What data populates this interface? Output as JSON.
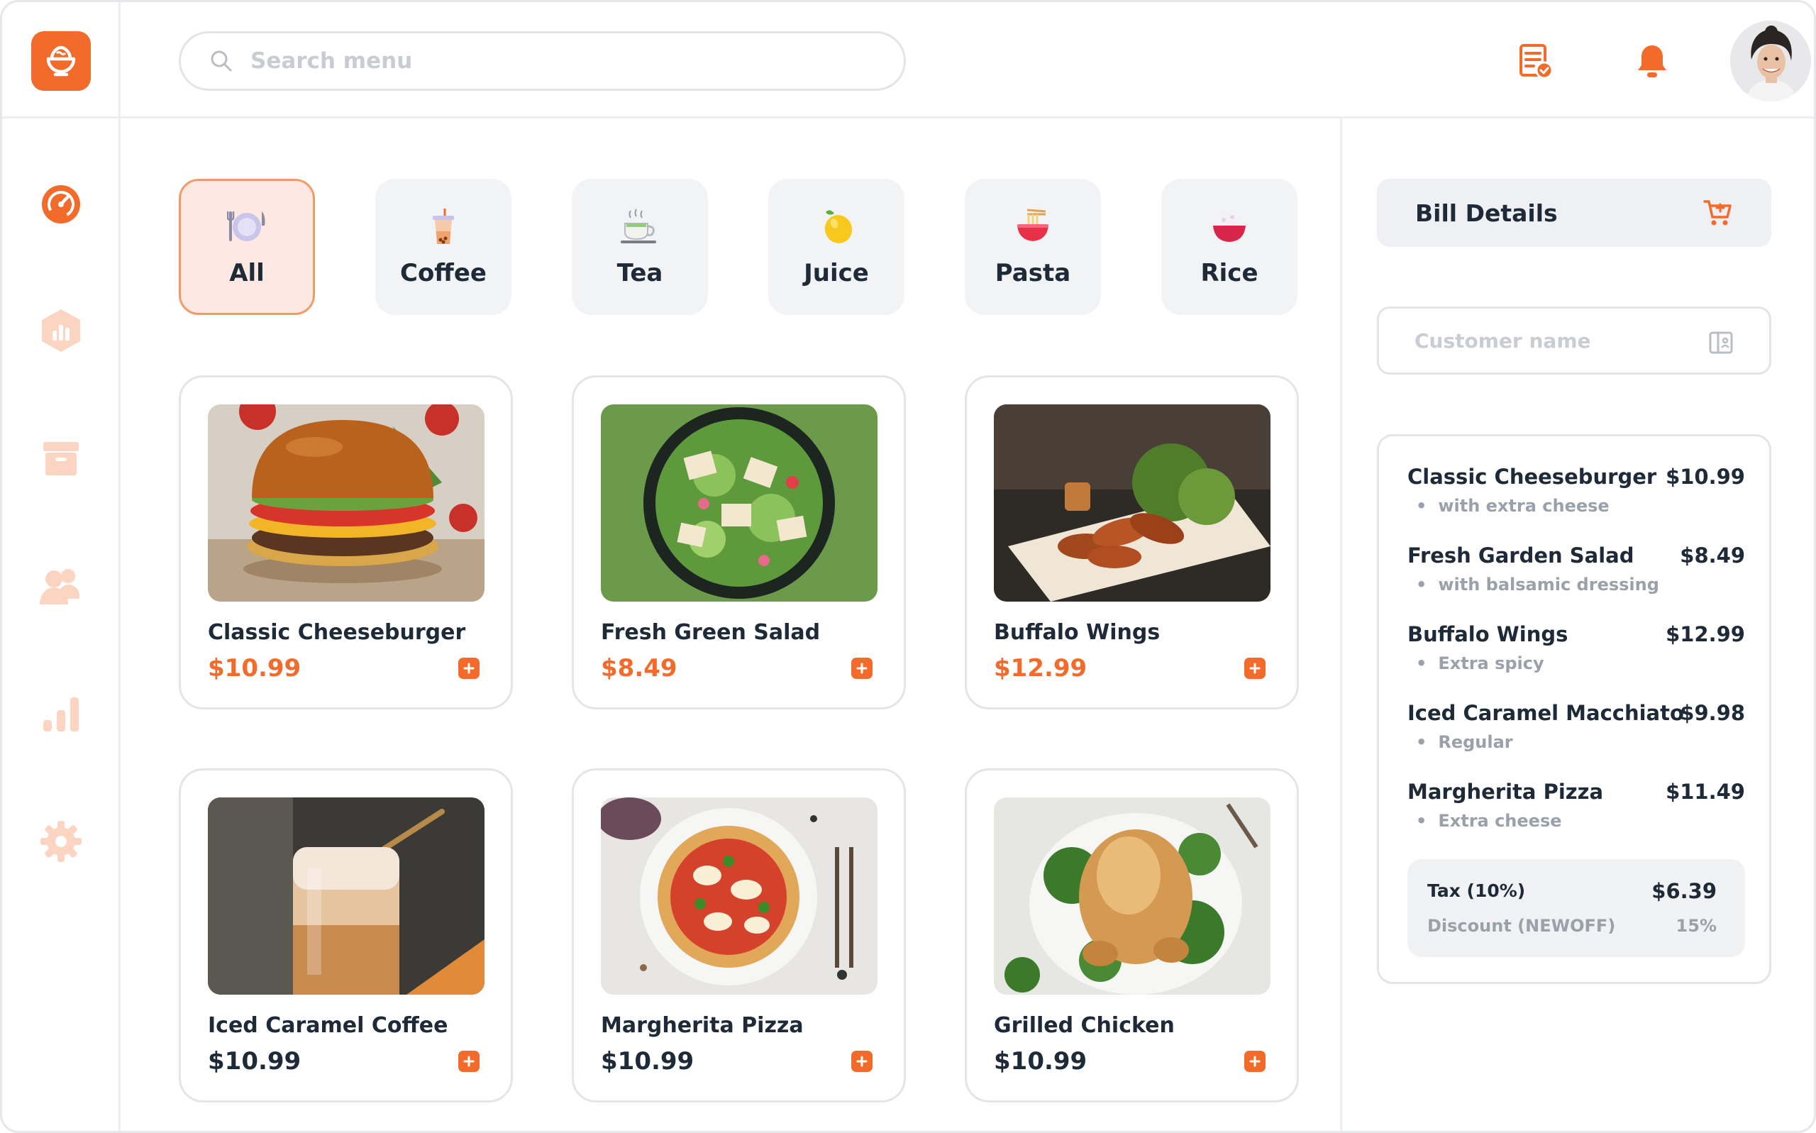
{
  "colors": {
    "accent": "#f26b2a",
    "accent_light": "#fde9e1",
    "text_dark": "#1e2a38",
    "muted": "#9aa1ab"
  },
  "header": {
    "search_placeholder": "Search menu",
    "icons": [
      "order-list-icon",
      "bell-icon"
    ],
    "avatar": "user-avatar"
  },
  "sidebar": {
    "items": [
      {
        "icon": "dashboard-icon",
        "active": true
      },
      {
        "icon": "analytics-hexagon-icon",
        "active": false
      },
      {
        "icon": "archive-box-icon",
        "active": false
      },
      {
        "icon": "users-icon",
        "active": false
      },
      {
        "icon": "bar-chart-icon",
        "active": false
      },
      {
        "icon": "settings-gear-icon",
        "active": false
      }
    ]
  },
  "categories": [
    {
      "label": "All",
      "icon": "plate-utensils-icon",
      "active": true
    },
    {
      "label": "Coffee",
      "icon": "iced-drink-icon",
      "active": false
    },
    {
      "label": "Tea",
      "icon": "tea-cup-icon",
      "active": false
    },
    {
      "label": "Juice",
      "icon": "lemon-icon",
      "active": false
    },
    {
      "label": "Pasta",
      "icon": "noodle-bowl-icon",
      "active": false
    },
    {
      "label": "Rice",
      "icon": "rice-bowl-icon",
      "active": false
    }
  ],
  "products": [
    {
      "name": "Classic Cheeseburger",
      "price": "$10.99",
      "image": "cheeseburger-photo",
      "price_color": "orange"
    },
    {
      "name": "Fresh Green Salad",
      "price": "$8.49",
      "image": "salad-photo",
      "price_color": "orange"
    },
    {
      "name": "Buffalo Wings",
      "price": "$12.99",
      "image": "wings-photo",
      "price_color": "orange"
    },
    {
      "name": "Iced Caramel Coffee",
      "price": "$10.99",
      "image": "iced-coffee-photo",
      "price_color": "dark"
    },
    {
      "name": "Margherita Pizza",
      "price": "$10.99",
      "image": "pizza-photo",
      "price_color": "dark"
    },
    {
      "name": "Grilled Chicken",
      "price": "$10.99",
      "image": "roast-chicken-photo",
      "price_color": "dark"
    }
  ],
  "bill": {
    "title": "Bill Details",
    "customer_placeholder": "Customer name",
    "items": [
      {
        "name": "Classic Cheeseburger",
        "price": "$10.99",
        "note": "with extra cheese"
      },
      {
        "name": "Fresh Garden Salad",
        "price": "$8.49",
        "note": "with balsamic dressing"
      },
      {
        "name": "Buffalo Wings",
        "price": "$12.99",
        "note": "Extra spicy"
      },
      {
        "name": "Iced Caramel Macchiato",
        "price": "$9.98",
        "note": "Regular"
      },
      {
        "name": "Margherita Pizza",
        "price": "$11.49",
        "note": "Extra cheese"
      }
    ],
    "tax_label": "Tax (10%)",
    "tax_value": "$6.39",
    "discount_label": "Discount (NEWOFF)",
    "discount_value": "15%"
  }
}
